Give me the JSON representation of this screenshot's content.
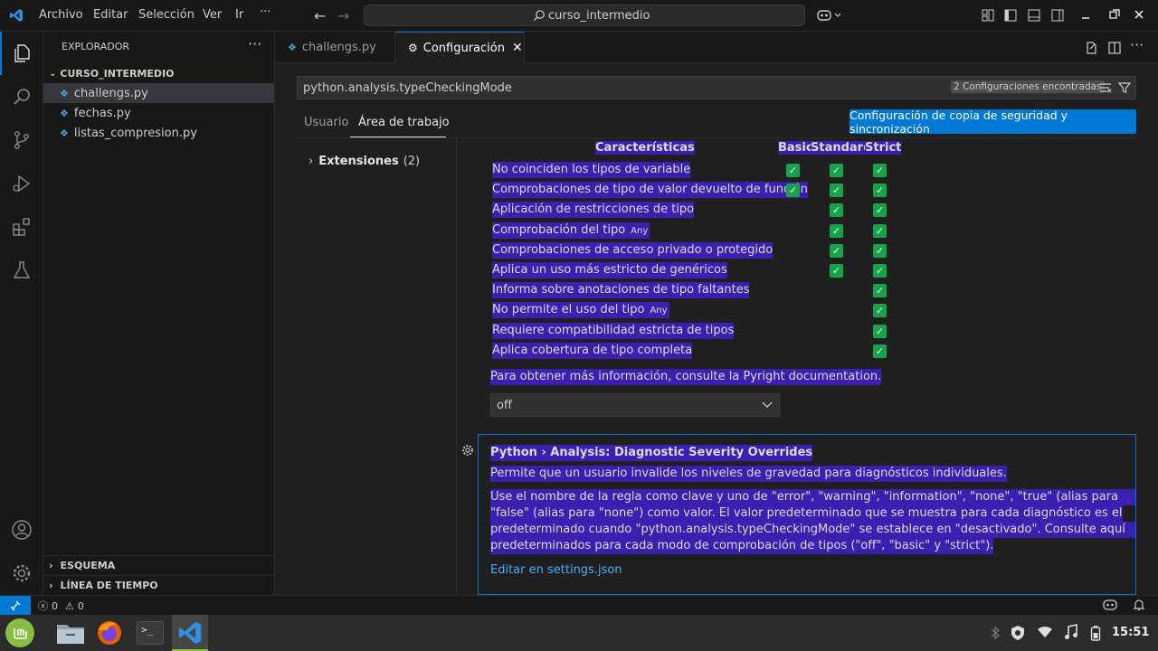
{
  "titlebar": {
    "menus": [
      "Archivo",
      "Editar",
      "Selección",
      "Ver",
      "Ir"
    ],
    "more": "···",
    "search": "curso_intermedio"
  },
  "sidebar": {
    "title": "EXPLORADOR",
    "folder": "CURSO_INTERMEDIO",
    "files": [
      "challengs.py",
      "fechas.py",
      "listas_compresion.py"
    ],
    "outline": "ESQUEMA",
    "timeline": "LÍNEA DE TIEMPO"
  },
  "tabs": [
    {
      "label": "challengs.py"
    },
    {
      "label": "Configuración"
    }
  ],
  "settings": {
    "search_value": "python.analysis.typeCheckingMode",
    "found_count": "2 Configuraciones encontradas",
    "scope_tabs": [
      "Usuario",
      "Área de trabajo"
    ],
    "sync_button": "Configuración de copia de seguridad y sincronización",
    "tree_item": "Extensiones",
    "tree_count": "(2)",
    "table_header": [
      "Características",
      "Basic",
      "Standard",
      "Strict"
    ],
    "rows": [
      {
        "label": "No coinciden los tipos de variable",
        "basic": true,
        "standard": true,
        "strict": true
      },
      {
        "label": "Comprobaciones de tipo de valor devuelto de función",
        "basic": true,
        "standard": true,
        "strict": true
      },
      {
        "label": "Aplicación de restricciones de tipo",
        "basic": false,
        "standard": true,
        "strict": true
      },
      {
        "label": "Comprobación del tipo",
        "code": "Any",
        "basic": false,
        "standard": true,
        "strict": true
      },
      {
        "label": "Comprobaciones de acceso privado o protegido",
        "basic": false,
        "standard": true,
        "strict": true
      },
      {
        "label": "Aplica un uso más estricto de genéricos",
        "basic": false,
        "standard": true,
        "strict": true
      },
      {
        "label": "Informa sobre anotaciones de tipo faltantes",
        "basic": false,
        "standard": false,
        "strict": true
      },
      {
        "label": "No permite el uso del tipo",
        "code": "Any",
        "basic": false,
        "standard": false,
        "strict": true
      },
      {
        "label": "Requiere compatibilidad estricta de tipos",
        "basic": false,
        "standard": false,
        "strict": true
      },
      {
        "label": "Aplica cobertura de tipo completa",
        "basic": false,
        "standard": false,
        "strict": true
      }
    ],
    "more_info": "Para obtener más información, consulte la Pyright documentation.",
    "select_value": "off",
    "override": {
      "title": "Python › Analysis: Diagnostic Severity Overrides",
      "desc1": "Permite que un usuario invalide los niveles de gravedad para diagnósticos individuales.",
      "desc2_l1": "Use el nombre de la regla como clave y uno de \"error\", \"warning\", \"information\", \"none\", \"true\" (alias para \"error\") o",
      "desc2_l2": "\"false\" (alias para \"none\") como valor. El valor predeterminado que se muestra para cada diagnóstico es el",
      "desc2_l3": "predeterminado cuando \"python.analysis.typeCheckingMode\" se establece en \"desactivado\". Consulte aquí los valores",
      "desc2_l4": "predeterminados para cada modo de comprobación de tipos (\"off\", \"basic\" y \"strict\").",
      "link": "Editar en settings.json"
    }
  },
  "statusbar": {
    "errors": "0",
    "warnings": "0"
  },
  "taskbar": {
    "clock": "15:51"
  },
  "colors": {
    "accent": "#0078d4",
    "highlight": "#3b1fb0",
    "check": "#16a34a"
  }
}
